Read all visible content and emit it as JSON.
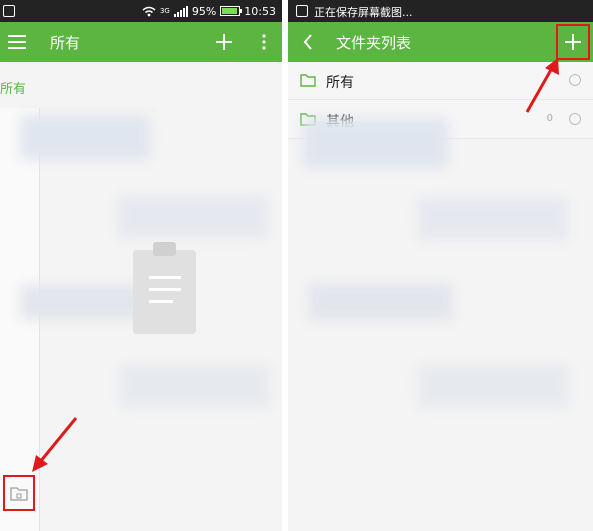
{
  "left_screen": {
    "status_bar": {
      "network_label": "3G",
      "battery_percent": "95%",
      "battery_level": 0.95,
      "time": "10:53"
    },
    "app_bar": {
      "menu_icon": "hamburger-menu-icon",
      "title": "所有",
      "add_icon": "plus-icon",
      "more_icon": "more-vertical-icon"
    },
    "section_label": "所有",
    "bottom_button_icon": "folder-icon"
  },
  "right_screen": {
    "status_bar": {
      "notice": "正在保存屏幕截图..."
    },
    "app_bar": {
      "back_icon": "back-arrow-icon",
      "title": "文件夹列表",
      "add_icon": "plus-icon"
    },
    "folders": [
      {
        "name": "所有",
        "icon": "folder-icon"
      },
      {
        "name": "其他",
        "icon": "folder-icon",
        "count": "0"
      }
    ]
  },
  "annotations": {
    "highlight_color": "#e01a1a",
    "accent_color": "#5bb540"
  }
}
